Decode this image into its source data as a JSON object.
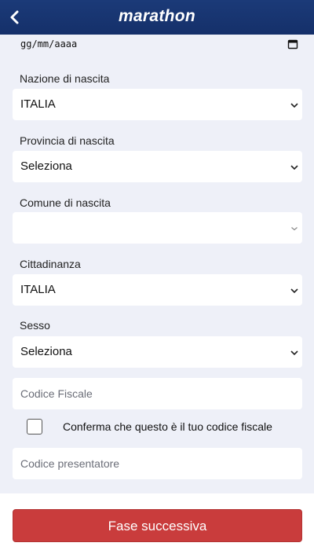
{
  "header": {
    "logo_text": "marathon"
  },
  "birth_date": {
    "value": "gg/mm/aaaa"
  },
  "fields": {
    "nazione": {
      "label": "Nazione di nascita",
      "value": "ITALIA"
    },
    "provincia": {
      "label": "Provincia di nascita",
      "value": "Seleziona"
    },
    "comune": {
      "label": "Comune di nascita",
      "value": ""
    },
    "cittadinanza": {
      "label": "Cittadinanza",
      "value": "ITALIA"
    },
    "sesso": {
      "label": "Sesso",
      "value": "Seleziona"
    },
    "codice_fiscale": {
      "placeholder": "Codice Fiscale"
    },
    "codice_presentatore": {
      "placeholder": "Codice presentatore"
    }
  },
  "confirm": {
    "label": "Conferma che questo è il tuo codice fiscale",
    "checked": false
  },
  "footer": {
    "next_label": "Fase successiva"
  },
  "colors": {
    "header": "#1b3a78",
    "page_bg": "#eef0f8",
    "primary_button": "#c93c3c"
  }
}
